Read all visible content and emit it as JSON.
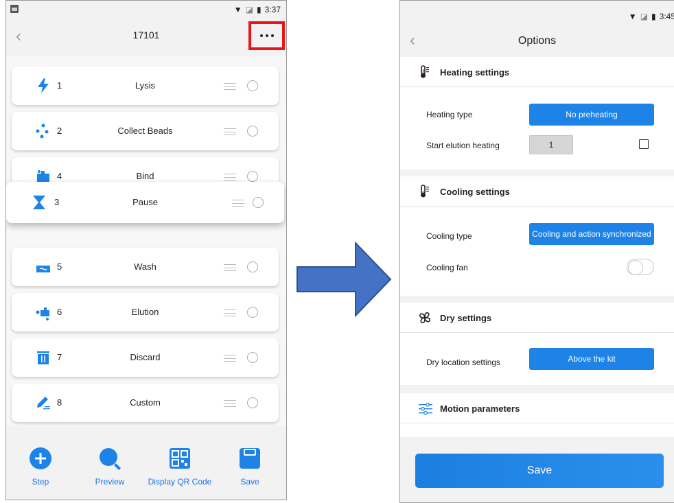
{
  "left_screen": {
    "status_time": "3:37",
    "title": "17101",
    "steps": [
      {
        "number": "1",
        "name": "Lysis",
        "icon": "lightning-icon"
      },
      {
        "number": "2",
        "name": "Collect Beads",
        "icon": "beads-icon"
      },
      {
        "number": "4",
        "name": "Bind",
        "icon": "bind-icon"
      },
      {
        "number": "3",
        "name": "Pause",
        "icon": "hourglass-icon"
      },
      {
        "number": "5",
        "name": "Wash",
        "icon": "wash-icon"
      },
      {
        "number": "6",
        "name": "Elution",
        "icon": "elution-icon"
      },
      {
        "number": "7",
        "name": "Discard",
        "icon": "trash-icon"
      },
      {
        "number": "8",
        "name": "Custom",
        "icon": "pen-icon"
      }
    ],
    "bottom_bar": {
      "step": "Step",
      "preview": "Preview",
      "qr": "Display QR Code",
      "save": "Save"
    }
  },
  "right_screen": {
    "status_time": "3:45",
    "title": "Options",
    "heating": {
      "title": "Heating settings",
      "type_label": "Heating type",
      "type_value": "No preheating",
      "elution_label": "Start elution heating",
      "elution_value": "1"
    },
    "cooling": {
      "title": "Cooling settings",
      "type_label": "Cooling type",
      "type_value": "Cooling and action synchronized",
      "fan_label": "Cooling fan"
    },
    "dry": {
      "title": "Dry settings",
      "location_label": "Dry location settings",
      "location_value": "Above the kit"
    },
    "motion": {
      "title": "Motion parameters"
    },
    "save": "Save"
  },
  "colors": {
    "accent": "#1d83e6",
    "highlight": "#e81616",
    "arrow": "#4472c4"
  }
}
